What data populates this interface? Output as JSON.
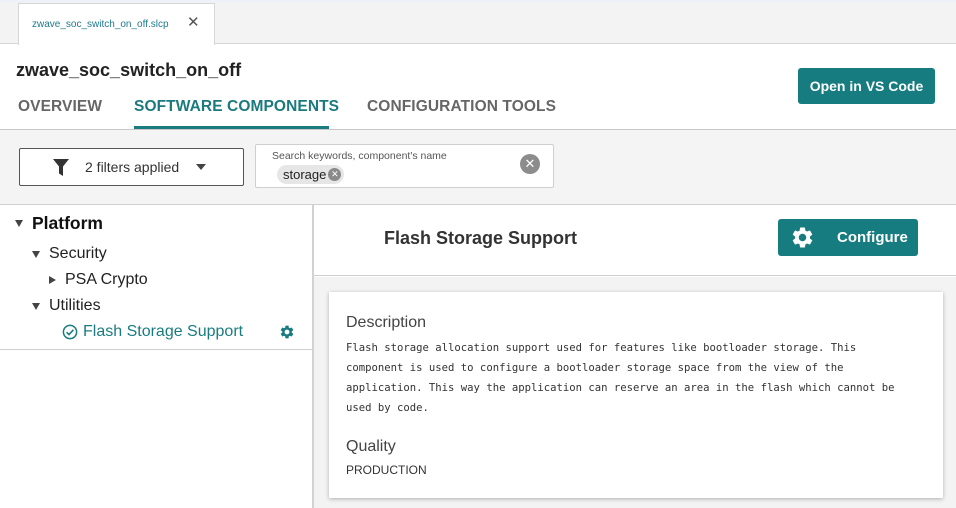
{
  "editor_tab": {
    "label": "zwave_soc_switch_on_off.slcp",
    "close": "✕"
  },
  "project": {
    "title": "zwave_soc_switch_on_off"
  },
  "nav_tabs": [
    {
      "label": "OVERVIEW"
    },
    {
      "label": "SOFTWARE COMPONENTS",
      "active": true
    },
    {
      "label": "CONFIGURATION TOOLS"
    }
  ],
  "actions": {
    "open_vscode": "Open in VS Code"
  },
  "filter": {
    "label": "2 filters applied",
    "icon": "filter-icon"
  },
  "search": {
    "placeholder": "Search keywords, component's name",
    "chip": "storage"
  },
  "tree": {
    "root": "Platform",
    "security": "Security",
    "psa_crypto": "PSA Crypto",
    "utilities": "Utilities",
    "selected": "Flash Storage Support"
  },
  "detail": {
    "title": "Flash Storage Support",
    "configure_label": "Configure",
    "description_heading": "Description",
    "description_lines": [
      "Flash storage allocation support used for features like bootloader storage. This",
      "component is used to configure a bootloader storage space from the view of the",
      "application. This way the application can reserve an area in the flash which cannot be",
      "used by code."
    ],
    "quality_heading": "Quality",
    "quality_value": "PRODUCTION"
  },
  "colors": {
    "accent": "#167c7f",
    "accent_text": "#1a7c80"
  }
}
